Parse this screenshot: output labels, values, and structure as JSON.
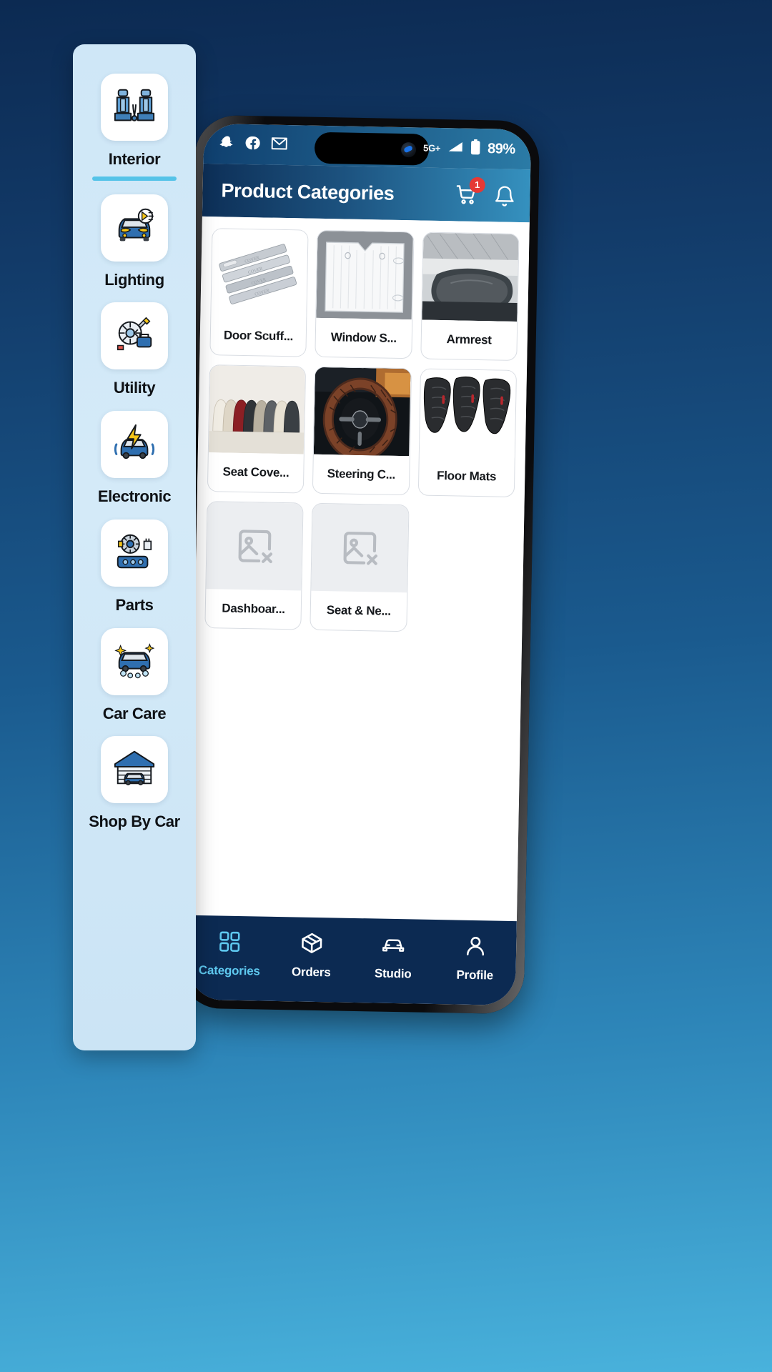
{
  "wallpaper": {
    "top_color": "#0c2a52",
    "bottom_color": "#49b2dc"
  },
  "status_bar": {
    "left_icons": [
      "snapchat-icon",
      "facebook-icon",
      "gmail-icon"
    ],
    "right_icons": [
      "alarm-icon",
      "call-wifi-icon",
      "data-transfer-icon",
      "signal-icon"
    ],
    "network_label": "5G+",
    "battery_label": "89%"
  },
  "header": {
    "title": "Product Categories",
    "cart_badge": "1",
    "cart_icon": "shopping-cart-icon",
    "bell_icon": "notification-bell-icon",
    "accent_dark": "#0d2f57",
    "accent_light": "#3591bf"
  },
  "products": [
    {
      "name": "Door Scuff...",
      "thumb": "door-scuff-plates",
      "has_image": true
    },
    {
      "name": "Window S...",
      "thumb": "window-sunshade",
      "has_image": true
    },
    {
      "name": "Armrest",
      "thumb": "car-armrest",
      "has_image": true
    },
    {
      "name": "Seat Cove...",
      "thumb": "seat-covers",
      "has_image": true
    },
    {
      "name": "Steering C...",
      "thumb": "steering-cover",
      "has_image": true
    },
    {
      "name": "Floor Mats",
      "thumb": "floor-mats",
      "has_image": true
    },
    {
      "name": "Dashboar...",
      "thumb": "broken-image",
      "has_image": false
    },
    {
      "name": "Seat & Ne...",
      "thumb": "broken-image",
      "has_image": false
    }
  ],
  "bottom_nav": {
    "active_color": "#5ec8ef",
    "items": [
      {
        "label": "Categories",
        "icon": "grid-squares-icon",
        "active": true
      },
      {
        "label": "Orders",
        "icon": "package-box-icon",
        "active": false
      },
      {
        "label": "Studio",
        "icon": "car-front-icon",
        "active": false
      },
      {
        "label": "Profile",
        "icon": "person-icon",
        "active": false
      }
    ]
  },
  "sidebar": {
    "accent": "#55c3e8",
    "items": [
      {
        "label": "Interior",
        "icon": "car-seats-icon",
        "selected": true
      },
      {
        "label": "Lighting",
        "icon": "car-headlight-icon",
        "selected": false
      },
      {
        "label": "Utility",
        "icon": "car-tools-icon",
        "selected": false
      },
      {
        "label": "Electronic",
        "icon": "car-electric-icon",
        "selected": false
      },
      {
        "label": "Parts",
        "icon": "engine-parts-icon",
        "selected": false
      },
      {
        "label": "Car Care",
        "icon": "car-wash-icon",
        "selected": false
      },
      {
        "label": "Shop By Car",
        "icon": "garage-icon",
        "selected": false
      }
    ]
  }
}
